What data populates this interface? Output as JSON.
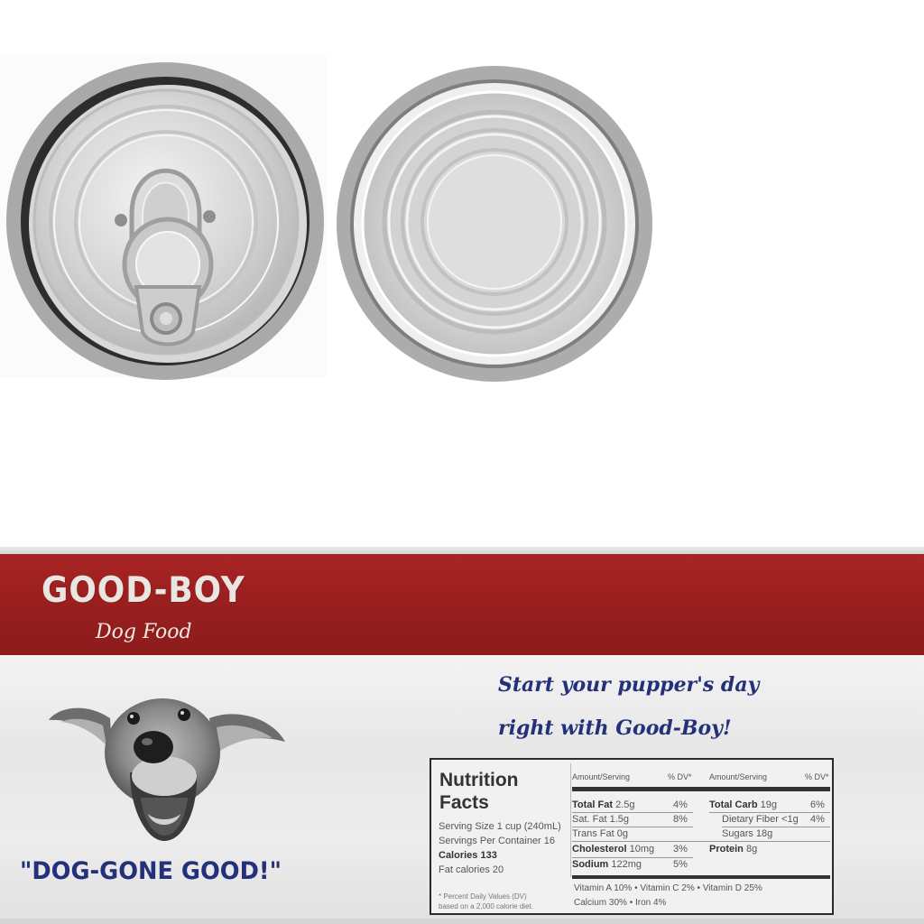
{
  "lids": [
    {
      "name": "pull-tab lid",
      "color": "#bdbdbd"
    },
    {
      "name": "plain lid",
      "color": "#c4c4c4"
    }
  ],
  "label": {
    "brand": "GOOD-BOY",
    "product": "Dog Food",
    "band_color": "#9b1f1f",
    "tagline": [
      "Start your pupper's day",
      "right with Good-Boy!"
    ],
    "slogan": "\"DOG-GONE GOOD!\"",
    "text_color": "#23307a"
  },
  "nutrition": {
    "title_line1": "Nutrition",
    "title_line2": "Facts",
    "serving_size": "Serving Size 1 cup (240mL)",
    "servings_per_container": "Servings Per Container 16",
    "calories": "Calories  133",
    "fat_calories": "Fat calories 20",
    "footnote": [
      "* Percent Daily Values (DV)",
      "based on a 2,000 calorie diet."
    ],
    "header_amount": "Amount/Serving",
    "header_dv": "% DV*",
    "left_rows": [
      {
        "label": "Total Fat",
        "amount": "2.5g",
        "dv": "4%",
        "bold": true
      },
      {
        "label": "Sat. Fat",
        "amount": "1.5g",
        "dv": "8%",
        "bold": false
      },
      {
        "label": "Trans Fat",
        "amount": "0g",
        "dv": "",
        "bold": false
      },
      {
        "label": "Cholesterol",
        "amount": "10mg",
        "dv": "3%",
        "bold": true
      },
      {
        "label": "Sodium",
        "amount": "122mg",
        "dv": "5%",
        "bold": true
      }
    ],
    "right_rows": [
      {
        "label": "Total Carb",
        "amount": "19g",
        "dv": "6%",
        "bold": true
      },
      {
        "label": "Dietary Fiber",
        "amount": "<1g",
        "dv": "4%",
        "bold": false
      },
      {
        "label": "Sugars",
        "amount": "18g",
        "dv": "",
        "bold": false
      },
      {
        "label": "Protein",
        "amount": "8g",
        "dv": "",
        "bold": true
      }
    ],
    "vitamins": [
      "Vitamin A 10% • Vitamin C 2% • Vitamin D 25%",
      "Calcium 30% • Iron 4%"
    ]
  }
}
